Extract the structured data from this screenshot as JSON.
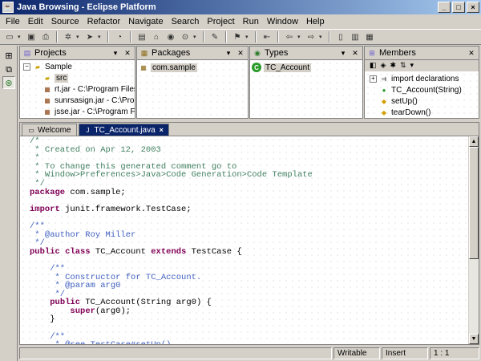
{
  "window": {
    "title": "Java Browsing - Eclipse Platform"
  },
  "menu": [
    "File",
    "Edit",
    "Source",
    "Refactor",
    "Navigate",
    "Search",
    "Project",
    "Run",
    "Window",
    "Help"
  ],
  "views": {
    "projects": {
      "title": "Projects",
      "items": [
        {
          "label": "Sample"
        },
        {
          "label": "src"
        },
        {
          "label": "rt.jar - C:\\Program Files"
        },
        {
          "label": "sunrsasign.jar - C:\\Prog"
        },
        {
          "label": "jsse.jar - C:\\Program Fi"
        }
      ]
    },
    "packages": {
      "title": "Packages",
      "items": [
        {
          "label": "com.sample"
        }
      ]
    },
    "types": {
      "title": "Types",
      "items": [
        {
          "label": "TC_Account"
        }
      ]
    },
    "members": {
      "title": "Members",
      "items": [
        {
          "label": "import declarations"
        },
        {
          "label": "TC_Account(String)"
        },
        {
          "label": "setUp()"
        },
        {
          "label": "tearDown()"
        }
      ]
    }
  },
  "editor": {
    "tabs": [
      {
        "label": "Welcome"
      },
      {
        "label": "TC_Account.java"
      }
    ]
  },
  "status": {
    "mode": "Writable",
    "insert": "Insert",
    "position": "1 : 1"
  }
}
